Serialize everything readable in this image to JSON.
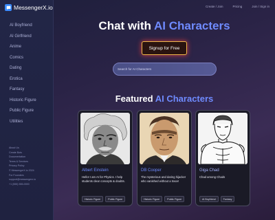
{
  "brand": {
    "name": "MessengerX.io",
    "accent": "#3a8bff"
  },
  "sidebar": {
    "items": [
      {
        "label": "AI Boyfriend"
      },
      {
        "label": "AI Girlfriend"
      },
      {
        "label": "Anime"
      },
      {
        "label": "Comics"
      },
      {
        "label": "Dating"
      },
      {
        "label": "Erotica"
      },
      {
        "label": "Fantasy"
      },
      {
        "label": "Historic Figure"
      },
      {
        "label": "Public Figure"
      },
      {
        "label": "Utilities"
      }
    ],
    "footer": [
      "About Us",
      "Create Bots",
      "Documentation",
      "Terms & Services",
      "Privacy Policy",
      "© MessengerX.io 2024",
      "For Founders",
      "support@messengerx.io",
      "+1 (555) 555-0000"
    ]
  },
  "topnav": {
    "create_label": "Create / Join",
    "pricing_label": "Pricing",
    "auth_label": "Join / Sign in"
  },
  "hero": {
    "title_part1": "Chat with ",
    "title_accent": "AI Characters",
    "signup_label": "Signup for Free",
    "search_placeholder": "Search for AI Characters"
  },
  "featured": {
    "title_part1": "Featured ",
    "title_accent": "AI Characters",
    "cards": [
      {
        "name": "Albert Einstein",
        "desc": "Hello! I am AI for Physics. I help students clear concepts & doubts.",
        "tags": [
          "Historic Figure",
          "Public Figure"
        ]
      },
      {
        "name": "DB Cooper",
        "desc": "The mysterious and daring hijacker who vanished without a trace!",
        "tags": [
          "Historic Figure",
          "Public Figure"
        ]
      },
      {
        "name": "Giga Chad",
        "desc": "Chad among Chads",
        "tags": [
          "AI Boyfriend",
          "Fantasy"
        ]
      }
    ]
  },
  "colors": {
    "accent": "#6f8bff",
    "signup_border": "#f2b94b",
    "signup_glow": "#e23c3c"
  }
}
